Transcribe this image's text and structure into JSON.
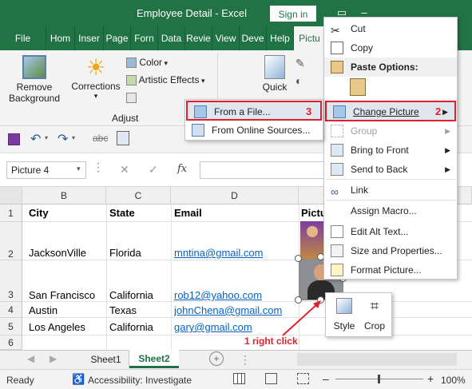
{
  "window": {
    "title": "Employee Detail  -  Excel",
    "signin": "Sign in"
  },
  "tabs": [
    "File",
    "Hom",
    "Inser",
    "Page",
    "Forn",
    "Data",
    "Revie",
    "View",
    "Deve",
    "Help",
    "Pictu"
  ],
  "ribbon": {
    "remove_bg": [
      "Remove",
      "Background"
    ],
    "corrections": "Corrections",
    "color": "Color",
    "artistic": "Artistic Effects",
    "quick": "Quick",
    "adjust_group": "Adjust"
  },
  "formula": {
    "namebox": "Picture 4",
    "fx": "fx"
  },
  "columns": [
    "B",
    "C",
    "D"
  ],
  "col_pic": "Pictu",
  "rows": [
    "1",
    "2",
    "3",
    "4",
    "5",
    "6"
  ],
  "cells": {
    "header": [
      "City",
      "State",
      "Email"
    ],
    "r2": [
      "JacksonVille",
      "Florida",
      "mntina@gmail.com"
    ],
    "r3": [
      "San Francisco",
      "California",
      "rob12@yahoo.com"
    ],
    "r4": [
      "Austin",
      "Texas",
      "johnChena@gmail.com"
    ],
    "r5": [
      "Los Angeles",
      "California",
      "gary@gmail.com"
    ]
  },
  "context_menu": {
    "cut": "Cut",
    "copy": "Copy",
    "paste_options": "Paste Options:",
    "change_picture": "Change Picture",
    "change_num": "2",
    "group": "Group",
    "bring_front": "Bring to Front",
    "send_back": "Send to Back",
    "link": "Link",
    "assign_macro": "Assign Macro...",
    "edit_alt": "Edit Alt Text...",
    "size_props": "Size and Properties...",
    "format_picture": "Format Picture..."
  },
  "submenu": {
    "from_file": "From a File...",
    "from_file_num": "3",
    "from_online": "From Online Sources..."
  },
  "mini": {
    "style": "Style",
    "crop": "Crop"
  },
  "annotation": "1 right click",
  "sheets": [
    "Sheet1",
    "Sheet2"
  ],
  "status": {
    "ready": "Ready",
    "accessibility": "Accessibility: Investigate",
    "zoom": "100%"
  },
  "colors": {
    "excel_green": "#217346",
    "highlight_red": "#e0202c",
    "link_blue": "#0563c1"
  }
}
